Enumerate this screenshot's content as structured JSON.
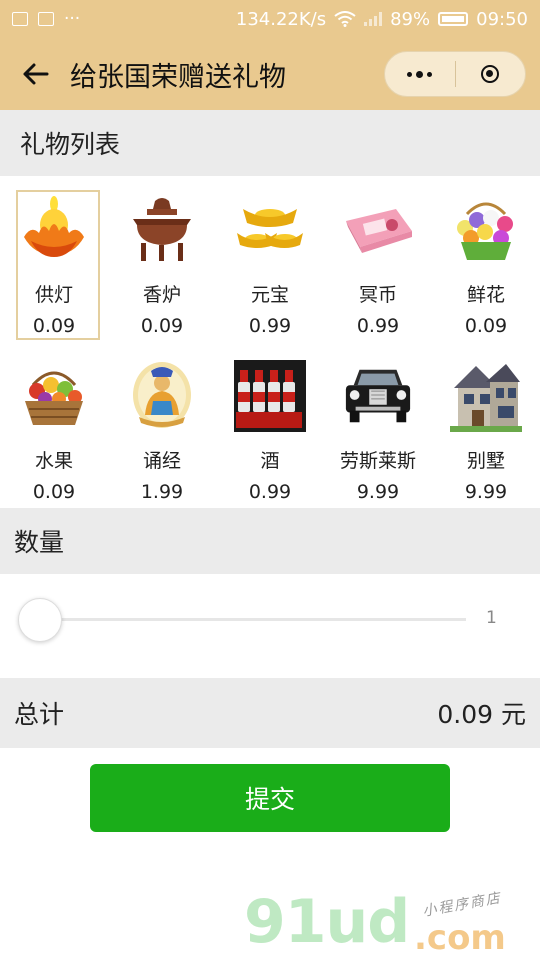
{
  "status_bar": {
    "speed": "134.22K/s",
    "battery": "89%",
    "time": "09:50",
    "dots": "···"
  },
  "nav": {
    "title": "给张国荣赠送礼物"
  },
  "gift_section": {
    "title": "礼物列表"
  },
  "gifts": [
    {
      "name": "供灯",
      "price": "0.09"
    },
    {
      "name": "香炉",
      "price": "0.09"
    },
    {
      "name": "元宝",
      "price": "0.99"
    },
    {
      "name": "冥币",
      "price": "0.99"
    },
    {
      "name": "鲜花",
      "price": "0.09"
    },
    {
      "name": "水果",
      "price": "0.09"
    },
    {
      "name": "诵经",
      "price": "1.99"
    },
    {
      "name": "酒",
      "price": "0.99"
    },
    {
      "name": "劳斯莱斯",
      "price": "9.99"
    },
    {
      "name": "别墅",
      "price": "9.99"
    }
  ],
  "quantity": {
    "title": "数量",
    "value": "1"
  },
  "total": {
    "label": "总计",
    "value": "0.09 元"
  },
  "submit_label": "提交",
  "watermark": {
    "main": "91ud",
    "domain": ".com",
    "tagline": "小程序商店"
  },
  "colors": {
    "header_bg": "#e9c98f",
    "section_bg": "#ebebeb",
    "primary_green": "#1aad19",
    "selected_border": "#e4cf9f"
  }
}
